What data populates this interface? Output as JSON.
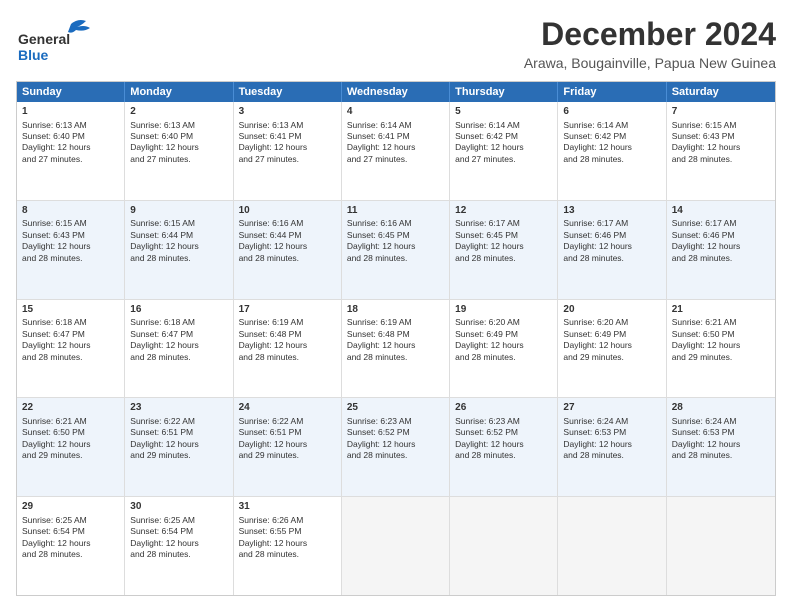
{
  "header": {
    "logo_line1": "General",
    "logo_line2": "Blue",
    "main_title": "December 2024",
    "subtitle": "Arawa, Bougainville, Papua New Guinea"
  },
  "calendar": {
    "days_of_week": [
      "Sunday",
      "Monday",
      "Tuesday",
      "Wednesday",
      "Thursday",
      "Friday",
      "Saturday"
    ],
    "rows": [
      [
        {
          "day": "1",
          "lines": [
            "Sunrise: 6:13 AM",
            "Sunset: 6:40 PM",
            "Daylight: 12 hours",
            "and 27 minutes."
          ]
        },
        {
          "day": "2",
          "lines": [
            "Sunrise: 6:13 AM",
            "Sunset: 6:40 PM",
            "Daylight: 12 hours",
            "and 27 minutes."
          ]
        },
        {
          "day": "3",
          "lines": [
            "Sunrise: 6:13 AM",
            "Sunset: 6:41 PM",
            "Daylight: 12 hours",
            "and 27 minutes."
          ]
        },
        {
          "day": "4",
          "lines": [
            "Sunrise: 6:14 AM",
            "Sunset: 6:41 PM",
            "Daylight: 12 hours",
            "and 27 minutes."
          ]
        },
        {
          "day": "5",
          "lines": [
            "Sunrise: 6:14 AM",
            "Sunset: 6:42 PM",
            "Daylight: 12 hours",
            "and 27 minutes."
          ]
        },
        {
          "day": "6",
          "lines": [
            "Sunrise: 6:14 AM",
            "Sunset: 6:42 PM",
            "Daylight: 12 hours",
            "and 28 minutes."
          ]
        },
        {
          "day": "7",
          "lines": [
            "Sunrise: 6:15 AM",
            "Sunset: 6:43 PM",
            "Daylight: 12 hours",
            "and 28 minutes."
          ]
        }
      ],
      [
        {
          "day": "8",
          "lines": [
            "Sunrise: 6:15 AM",
            "Sunset: 6:43 PM",
            "Daylight: 12 hours",
            "and 28 minutes."
          ]
        },
        {
          "day": "9",
          "lines": [
            "Sunrise: 6:15 AM",
            "Sunset: 6:44 PM",
            "Daylight: 12 hours",
            "and 28 minutes."
          ]
        },
        {
          "day": "10",
          "lines": [
            "Sunrise: 6:16 AM",
            "Sunset: 6:44 PM",
            "Daylight: 12 hours",
            "and 28 minutes."
          ]
        },
        {
          "day": "11",
          "lines": [
            "Sunrise: 6:16 AM",
            "Sunset: 6:45 PM",
            "Daylight: 12 hours",
            "and 28 minutes."
          ]
        },
        {
          "day": "12",
          "lines": [
            "Sunrise: 6:17 AM",
            "Sunset: 6:45 PM",
            "Daylight: 12 hours",
            "and 28 minutes."
          ]
        },
        {
          "day": "13",
          "lines": [
            "Sunrise: 6:17 AM",
            "Sunset: 6:46 PM",
            "Daylight: 12 hours",
            "and 28 minutes."
          ]
        },
        {
          "day": "14",
          "lines": [
            "Sunrise: 6:17 AM",
            "Sunset: 6:46 PM",
            "Daylight: 12 hours",
            "and 28 minutes."
          ]
        }
      ],
      [
        {
          "day": "15",
          "lines": [
            "Sunrise: 6:18 AM",
            "Sunset: 6:47 PM",
            "Daylight: 12 hours",
            "and 28 minutes."
          ]
        },
        {
          "day": "16",
          "lines": [
            "Sunrise: 6:18 AM",
            "Sunset: 6:47 PM",
            "Daylight: 12 hours",
            "and 28 minutes."
          ]
        },
        {
          "day": "17",
          "lines": [
            "Sunrise: 6:19 AM",
            "Sunset: 6:48 PM",
            "Daylight: 12 hours",
            "and 28 minutes."
          ]
        },
        {
          "day": "18",
          "lines": [
            "Sunrise: 6:19 AM",
            "Sunset: 6:48 PM",
            "Daylight: 12 hours",
            "and 28 minutes."
          ]
        },
        {
          "day": "19",
          "lines": [
            "Sunrise: 6:20 AM",
            "Sunset: 6:49 PM",
            "Daylight: 12 hours",
            "and 28 minutes."
          ]
        },
        {
          "day": "20",
          "lines": [
            "Sunrise: 6:20 AM",
            "Sunset: 6:49 PM",
            "Daylight: 12 hours",
            "and 29 minutes."
          ]
        },
        {
          "day": "21",
          "lines": [
            "Sunrise: 6:21 AM",
            "Sunset: 6:50 PM",
            "Daylight: 12 hours",
            "and 29 minutes."
          ]
        }
      ],
      [
        {
          "day": "22",
          "lines": [
            "Sunrise: 6:21 AM",
            "Sunset: 6:50 PM",
            "Daylight: 12 hours",
            "and 29 minutes."
          ]
        },
        {
          "day": "23",
          "lines": [
            "Sunrise: 6:22 AM",
            "Sunset: 6:51 PM",
            "Daylight: 12 hours",
            "and 29 minutes."
          ]
        },
        {
          "day": "24",
          "lines": [
            "Sunrise: 6:22 AM",
            "Sunset: 6:51 PM",
            "Daylight: 12 hours",
            "and 29 minutes."
          ]
        },
        {
          "day": "25",
          "lines": [
            "Sunrise: 6:23 AM",
            "Sunset: 6:52 PM",
            "Daylight: 12 hours",
            "and 28 minutes."
          ]
        },
        {
          "day": "26",
          "lines": [
            "Sunrise: 6:23 AM",
            "Sunset: 6:52 PM",
            "Daylight: 12 hours",
            "and 28 minutes."
          ]
        },
        {
          "day": "27",
          "lines": [
            "Sunrise: 6:24 AM",
            "Sunset: 6:53 PM",
            "Daylight: 12 hours",
            "and 28 minutes."
          ]
        },
        {
          "day": "28",
          "lines": [
            "Sunrise: 6:24 AM",
            "Sunset: 6:53 PM",
            "Daylight: 12 hours",
            "and 28 minutes."
          ]
        }
      ],
      [
        {
          "day": "29",
          "lines": [
            "Sunrise: 6:25 AM",
            "Sunset: 6:54 PM",
            "Daylight: 12 hours",
            "and 28 minutes."
          ]
        },
        {
          "day": "30",
          "lines": [
            "Sunrise: 6:25 AM",
            "Sunset: 6:54 PM",
            "Daylight: 12 hours",
            "and 28 minutes."
          ]
        },
        {
          "day": "31",
          "lines": [
            "Sunrise: 6:26 AM",
            "Sunset: 6:55 PM",
            "Daylight: 12 hours",
            "and 28 minutes."
          ]
        },
        {
          "day": "",
          "lines": []
        },
        {
          "day": "",
          "lines": []
        },
        {
          "day": "",
          "lines": []
        },
        {
          "day": "",
          "lines": []
        }
      ]
    ]
  }
}
